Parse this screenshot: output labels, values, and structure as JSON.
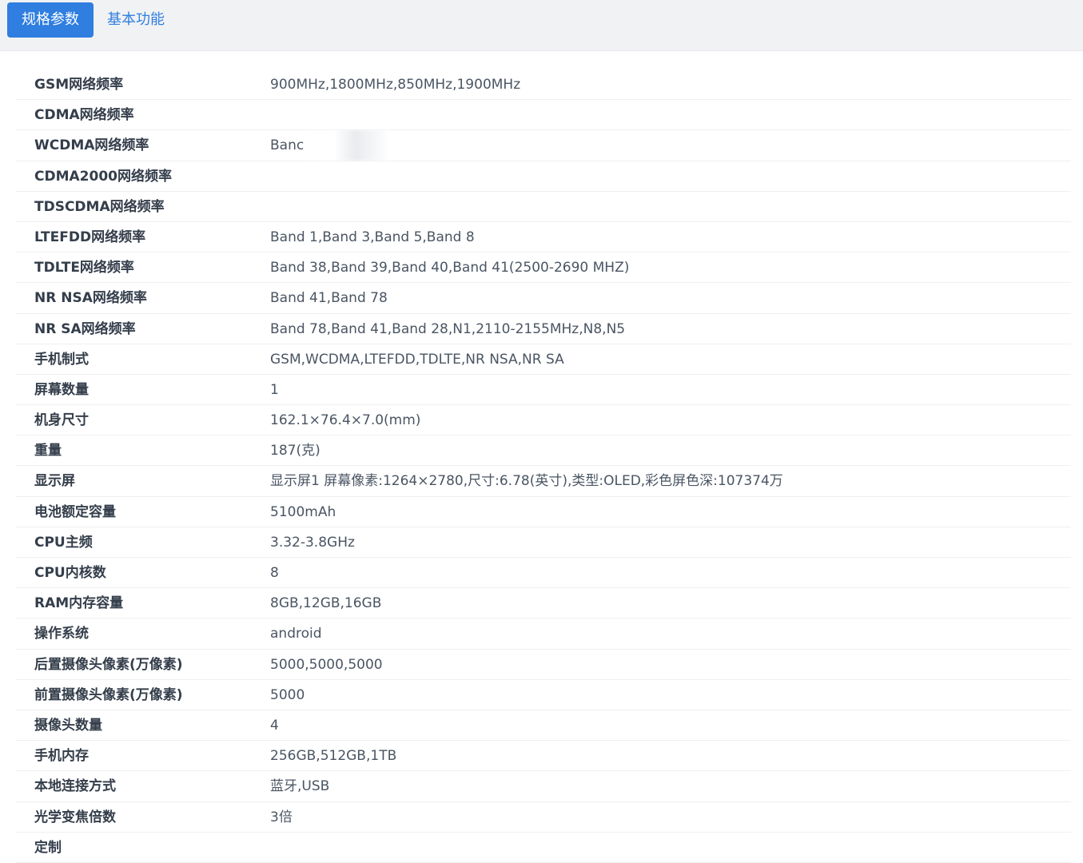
{
  "tabs": [
    {
      "label": "规格参数",
      "active": true
    },
    {
      "label": "基本功能",
      "active": false
    }
  ],
  "specs": [
    {
      "label": "GSM网络频率",
      "value": "900MHz,1800MHz,850MHz,1900MHz"
    },
    {
      "label": "CDMA网络频率",
      "value": ""
    },
    {
      "label": "WCDMA网络频率",
      "value": "Banc",
      "partially_obscured": true
    },
    {
      "label": "CDMA2000网络频率",
      "value": ""
    },
    {
      "label": "TDSCDMA网络频率",
      "value": ""
    },
    {
      "label": "LTEFDD网络频率",
      "value": "Band 1,Band 3,Band 5,Band 8"
    },
    {
      "label": "TDLTE网络频率",
      "value": "Band 38,Band 39,Band 40,Band 41(2500-2690 MHZ)"
    },
    {
      "label": "NR NSA网络频率",
      "value": "Band 41,Band 78"
    },
    {
      "label": "NR SA网络频率",
      "value": "Band 78,Band 41,Band 28,N1,2110-2155MHz,N8,N5"
    },
    {
      "label": "手机制式",
      "value": "GSM,WCDMA,LTEFDD,TDLTE,NR NSA,NR SA"
    },
    {
      "label": "屏幕数量",
      "value": "1"
    },
    {
      "label": "机身尺寸",
      "value": "162.1×76.4×7.0(mm)"
    },
    {
      "label": "重量",
      "value": "187(克)"
    },
    {
      "label": "显示屏",
      "value": "显示屏1 屏幕像素:1264×2780,尺寸:6.78(英寸),类型:OLED,彩色屏色深:107374万"
    },
    {
      "label": "电池额定容量",
      "value": "5100mAh"
    },
    {
      "label": "CPU主频",
      "value": "3.32-3.8GHz"
    },
    {
      "label": "CPU内核数",
      "value": "8"
    },
    {
      "label": "RAM内存容量",
      "value": "8GB,12GB,16GB"
    },
    {
      "label": "操作系统",
      "value": "android"
    },
    {
      "label": "后置摄像头像素(万像素)",
      "value": "5000,5000,5000"
    },
    {
      "label": "前置摄像头像素(万像素)",
      "value": "5000"
    },
    {
      "label": "摄像头数量",
      "value": "4"
    },
    {
      "label": "手机内存",
      "value": "256GB,512GB,1TB"
    },
    {
      "label": "本地连接方式",
      "value": "蓝牙,USB"
    },
    {
      "label": "光学变焦倍数",
      "value": "3倍"
    },
    {
      "label": "定制",
      "value": ""
    }
  ]
}
